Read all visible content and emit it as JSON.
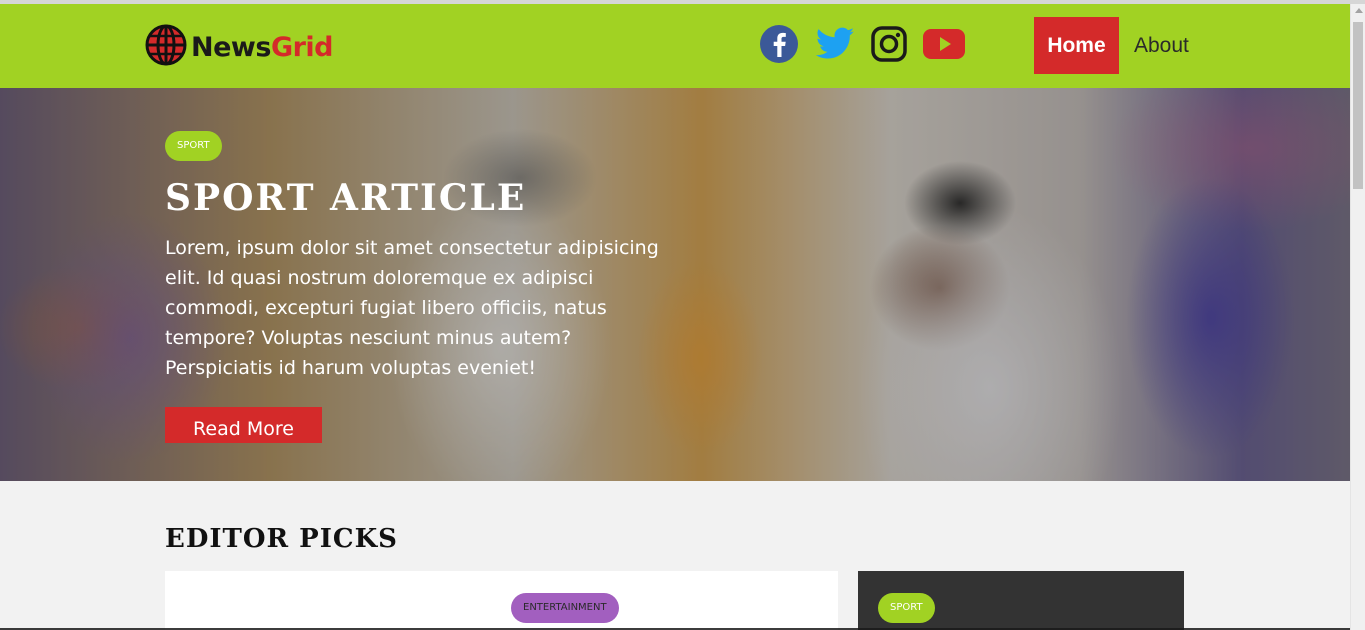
{
  "header": {
    "logo": {
      "text_part1": "News",
      "text_part2": "Grid",
      "icon": "globe-icon"
    },
    "socials": [
      {
        "name": "facebook",
        "icon": "facebook-icon",
        "color": "#3b5998"
      },
      {
        "name": "twitter",
        "icon": "twitter-icon",
        "color": "#1da1f2"
      },
      {
        "name": "instagram",
        "icon": "instagram-icon",
        "color": "#1a1a1a"
      },
      {
        "name": "youtube",
        "icon": "youtube-icon",
        "color": "#d42a2a"
      }
    ],
    "nav": {
      "home": "Home",
      "about": "About"
    },
    "bg_color": "#a1d223",
    "accent_color": "#d42a2a"
  },
  "hero": {
    "badge": "SPORT",
    "title": "SPORT ARTICLE",
    "text": "Lorem, ipsum dolor sit amet consectetur adipisicing elit. Id quasi nostrum doloremque ex adipisci commodi, excepturi fugiat libero officiis, natus tempore? Voluptas nesciunt minus autem? Perspiciatis id harum voluptas eveniet!",
    "button": "Read More"
  },
  "editor_picks": {
    "title": "EDITOR PICKS",
    "cards": [
      {
        "badge": "ENTERTAINMENT",
        "badge_color": "#a25fbf"
      },
      {
        "badge": "SPORT",
        "badge_color": "#a1d223"
      }
    ]
  }
}
